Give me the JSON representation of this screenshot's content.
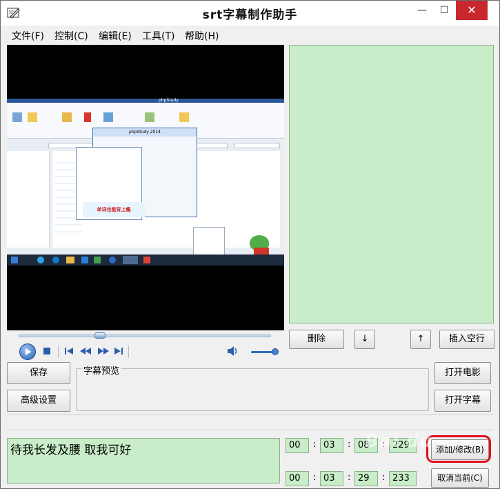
{
  "window": {
    "title": "srt字幕制作助手",
    "controls": {
      "minimize": "—",
      "maximize": "☐",
      "close": "✕"
    }
  },
  "menu": [
    {
      "label": "文件(F)"
    },
    {
      "label": "控制(C)"
    },
    {
      "label": "编辑(E)"
    },
    {
      "label": "工具(T)"
    },
    {
      "label": "帮助(H)"
    }
  ],
  "video": {
    "embedded_window_title": "phpStudy",
    "embedded_dialog_title": "phpStudy 2014",
    "embedded_ad": "单词也能背上瘾"
  },
  "list_buttons": {
    "delete": "删除",
    "down": "↓",
    "up": "↑",
    "insert_blank": "插入空行"
  },
  "left_buttons": {
    "save": "保存",
    "advanced": "高级设置"
  },
  "preview": {
    "label": "字幕预览"
  },
  "right_buttons": {
    "open_movie": "打开电影",
    "open_subtitle": "打开字幕"
  },
  "subtitle_input": {
    "value": "待我长发及腰  取我可好"
  },
  "start_time": {
    "h": "00",
    "m": "03",
    "s": "08",
    "ms": "229"
  },
  "end_time": {
    "h": "00",
    "m": "03",
    "s": "29",
    "ms": "233"
  },
  "action_buttons": {
    "add_modify": "添加/修改(B)",
    "cancel_current": "取消当前(C)"
  },
  "watermark": "Bai du"
}
